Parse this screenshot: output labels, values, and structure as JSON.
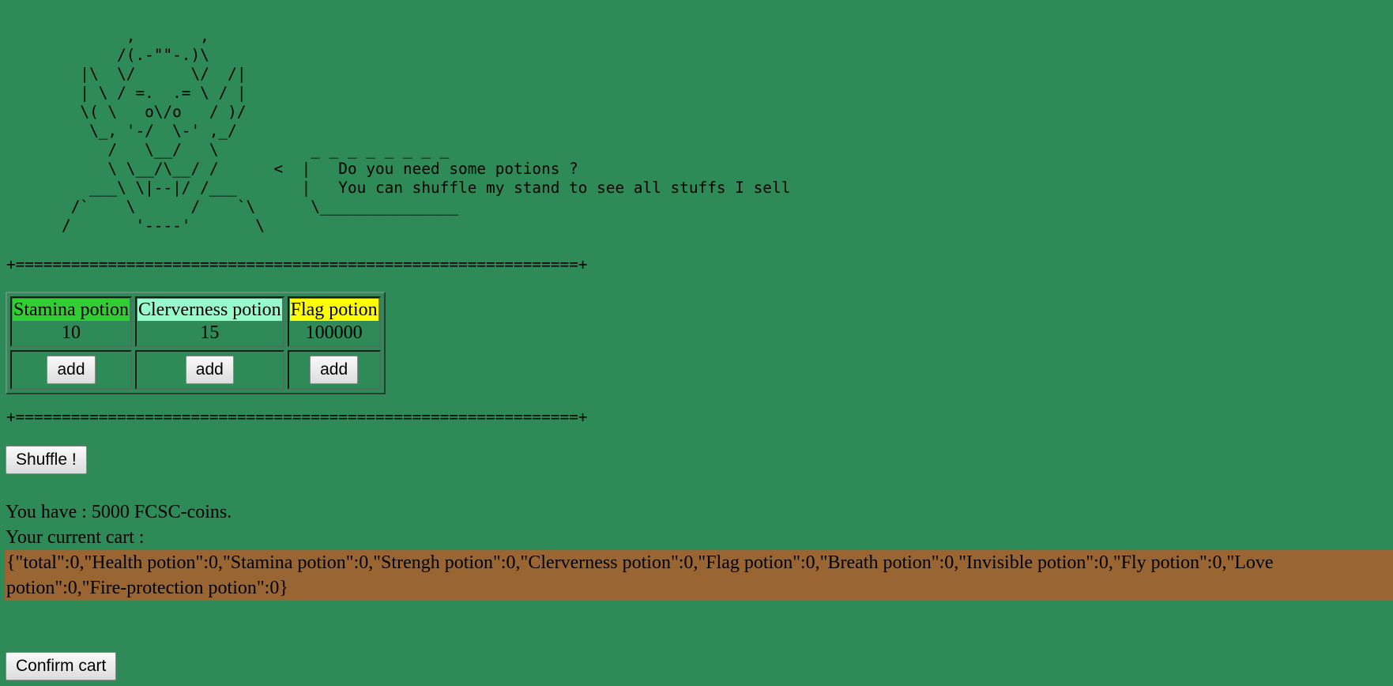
{
  "merchant": {
    "ascii_art": "             ,       ,\n            /(.-\"\"-.)\\\n        |\\  \\/      \\/  /|\n        | \\ / =.  .= \\ / |\n        \\( \\   o\\/o   / )/\n         \\_, '-/  \\-' ,_/\n           /   \\__/   \\          _ _ _ _ _ _ _ _\n           \\ \\__/\\__/ /      <  |   Do you need some potions ?\n         ___\\ \\|--|/ /___       |   You can shuffle my stand to see all stuffs I sell\n       /`    \\      /    `\\      \\_______________\n      /       '----'       \\"
  },
  "separator": "+=============================================================+",
  "stand": {
    "items": [
      {
        "name": "Stamina potion",
        "price": "10",
        "color": "#32cd32",
        "add_label": "add"
      },
      {
        "name": "Clerverness potion",
        "price": "15",
        "color": "#98fbcb",
        "add_label": "add"
      },
      {
        "name": "Flag potion",
        "price": "100000",
        "color": "#ffff00",
        "add_label": "add"
      }
    ]
  },
  "shuffle_label": "Shuffle !",
  "wallet": {
    "coins_text": "You have : 5000 FCSC-coins."
  },
  "cart": {
    "label": "Your current cart :",
    "content": "{\"total\":0,\"Health potion\":0,\"Stamina potion\":0,\"Strengh potion\":0,\"Clerverness potion\":0,\"Flag potion\":0,\"Breath potion\":0,\"Invisible potion\":0,\"Fly potion\":0,\"Love potion\":0,\"Fire-protection potion\":0}",
    "highlight_color": "#996633"
  },
  "confirm_label": "Confirm cart",
  "colors": {
    "background": "#2e8b57"
  }
}
